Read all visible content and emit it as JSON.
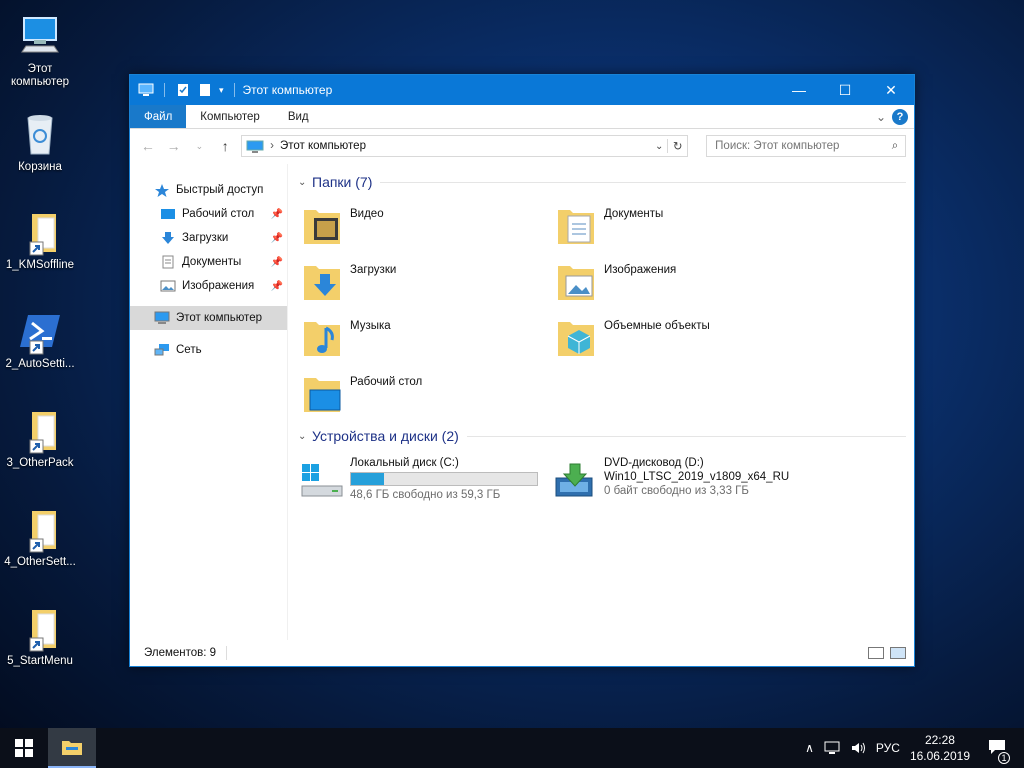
{
  "desktop": {
    "icons": [
      {
        "label": "Этот\nкомпьютер",
        "line1": "Этот",
        "line2": "компьютер",
        "icon": "computer-icon"
      },
      {
        "label": "Корзина",
        "icon": "recycle-bin-icon"
      },
      {
        "label": "1_KMSoffline",
        "icon": "folder-shortcut-icon"
      },
      {
        "label": "2_AutoSetti...",
        "icon": "powershell-shortcut-icon"
      },
      {
        "label": "3_OtherPack",
        "icon": "folder-shortcut-icon"
      },
      {
        "label": "4_OtherSett...",
        "icon": "folder-shortcut-icon"
      },
      {
        "label": "5_StartMenu",
        "icon": "folder-shortcut-icon"
      }
    ]
  },
  "window": {
    "title": "Этот компьютер",
    "controls": {
      "minimize": "—",
      "maximize": "☐",
      "close": "✕"
    },
    "ribbon_tabs": [
      "Файл",
      "Компьютер",
      "Вид"
    ],
    "address": "Этот компьютер",
    "search_placeholder": "Поиск: Этот компьютер",
    "nav": {
      "quick_access": "Быстрый доступ",
      "items": [
        "Рабочий стол",
        "Загрузки",
        "Документы",
        "Изображения"
      ],
      "this_pc": "Этот компьютер",
      "network": "Сеть"
    },
    "folders_header": "Папки (7)",
    "folders": [
      {
        "name": "Видео",
        "icon": "video-folder-icon"
      },
      {
        "name": "Документы",
        "icon": "documents-folder-icon"
      },
      {
        "name": "Загрузки",
        "icon": "downloads-folder-icon"
      },
      {
        "name": "Изображения",
        "icon": "pictures-folder-icon"
      },
      {
        "name": "Музыка",
        "icon": "music-folder-icon"
      },
      {
        "name": "Объемные объекты",
        "icon": "3d-objects-folder-icon"
      },
      {
        "name": "Рабочий стол",
        "icon": "desktop-folder-icon"
      }
    ],
    "drives_header": "Устройства и диски (2)",
    "drives": [
      {
        "name": "Локальный диск (C:)",
        "free": "48,6 ГБ свободно из 59,3 ГБ",
        "used_fraction": 0.18
      },
      {
        "name": "DVD-дисковод (D:)",
        "label": "Win10_LTSC_2019_v1809_x64_RU",
        "free": "0 байт свободно из 3,33 ГБ"
      }
    ],
    "status": "Элементов: 9"
  },
  "taskbar": {
    "language": "РУС",
    "time": "22:28",
    "date": "16.06.2019",
    "notifications": "1"
  },
  "colors": {
    "accent": "#0a78d7",
    "file_tab": "#1979ca",
    "drive_bar": "#26a0da",
    "folder": "#f3cf6a"
  }
}
